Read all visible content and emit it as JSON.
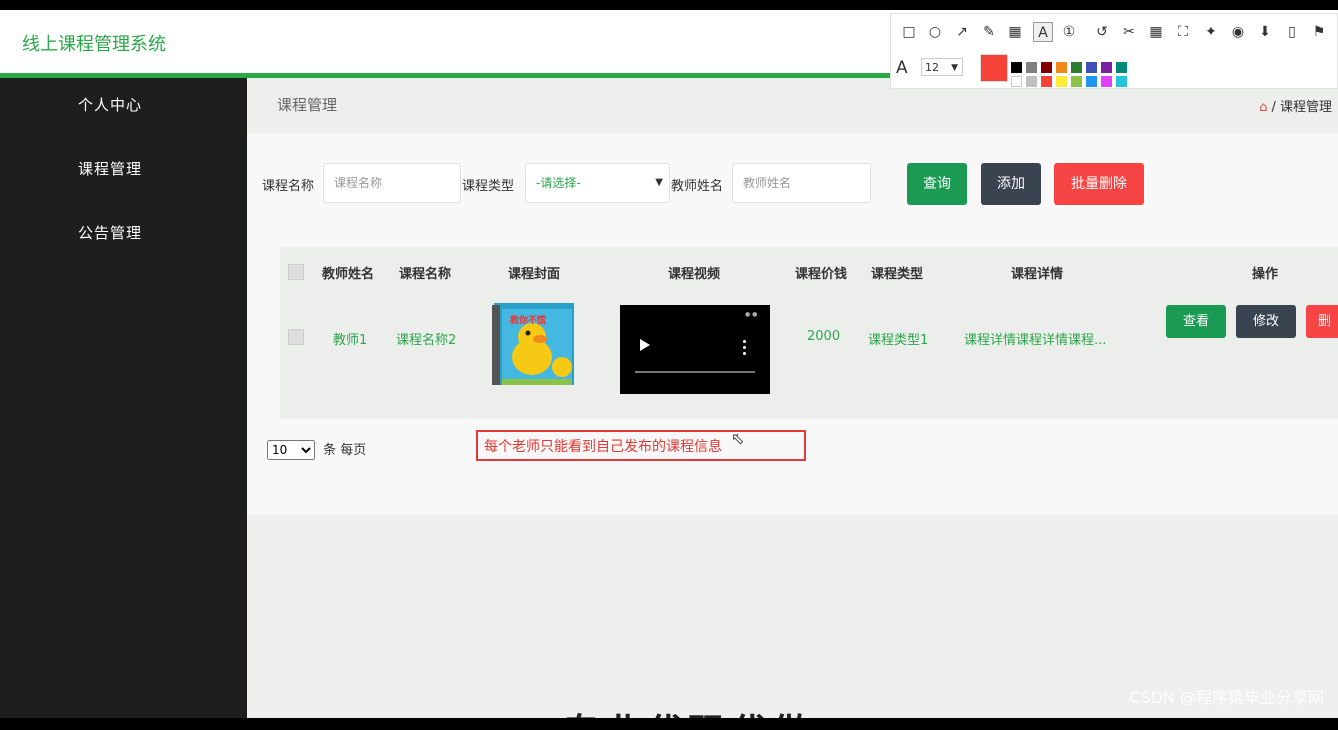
{
  "app": {
    "title": "线上课程管理系统"
  },
  "sidebar": {
    "items": [
      {
        "label": "个人中心"
      },
      {
        "label": "课程管理"
      },
      {
        "label": "公告管理"
      }
    ]
  },
  "page": {
    "title": "课程管理",
    "breadcrumb": [
      "课程管理"
    ]
  },
  "search": {
    "course_name_label": "课程名称",
    "course_name_placeholder": "课程名称",
    "course_type_label": "课程类型",
    "course_type_selected": "-请选择-",
    "teacher_name_label": "教师姓名",
    "teacher_name_placeholder": "教师姓名",
    "query_button": "查询",
    "add_button": "添加",
    "batch_delete_button": "批量删除"
  },
  "table": {
    "columns": [
      "教师姓名",
      "课程名称",
      "课程封面",
      "课程视频",
      "课程价钱",
      "课程类型",
      "课程详情",
      "操作"
    ],
    "rows": [
      {
        "teacher_name": "教师1",
        "course_name": "课程名称2",
        "cover_text": "教你不慌",
        "price": "2000",
        "course_type": "课程类型1",
        "details": "课程详情课程详情课程...",
        "actions": [
          "查看",
          "修改",
          "删"
        ]
      }
    ]
  },
  "pagination": {
    "page_size": "10",
    "suffix": "条 每页"
  },
  "annotation": {
    "text": "每个老师只能看到自己发布的课程信息"
  },
  "bottom_text": "专业代码代做",
  "toolbar": {
    "font_size": "12",
    "current_color": "#f44336"
  },
  "watermark": "CSDN @程序猿毕业分享网",
  "colors": {
    "brand_green": "#2aa84a",
    "sidebar_bg": "#1c1f1e",
    "danger": "#f64444",
    "dark_btn": "#3a4350"
  }
}
